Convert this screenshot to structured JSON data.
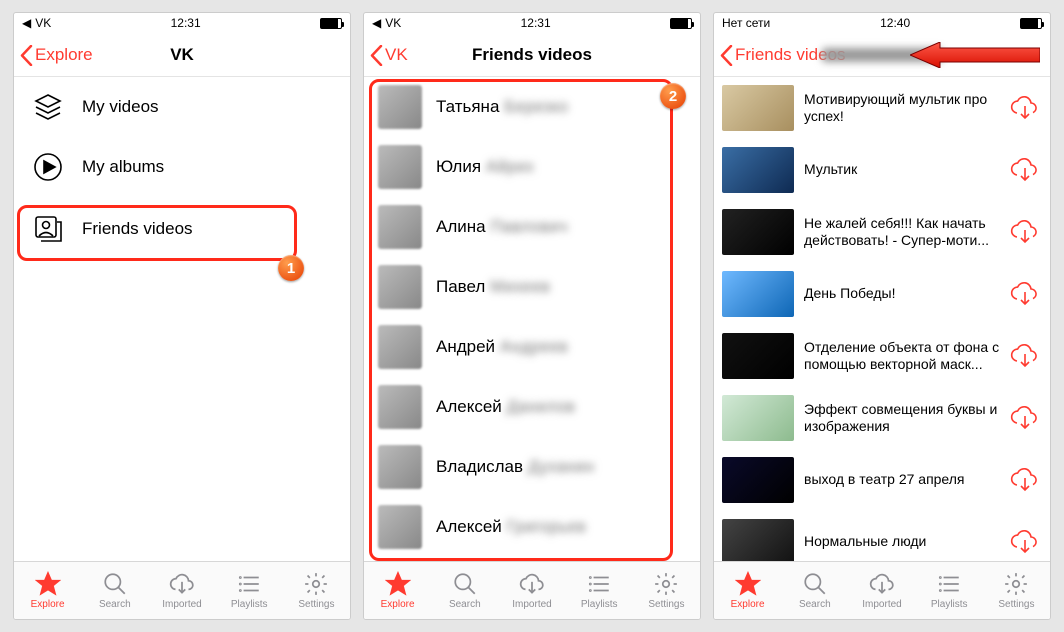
{
  "screens": [
    {
      "status": {
        "carrier": "VK",
        "time": "12:31"
      },
      "nav": {
        "back": "Explore",
        "title": "VK"
      },
      "menu": [
        {
          "label": "My videos"
        },
        {
          "label": "My albums"
        },
        {
          "label": "Friends videos"
        }
      ],
      "badge": "1"
    },
    {
      "status": {
        "carrier": "VK",
        "time": "12:31"
      },
      "nav": {
        "back": "VK",
        "title": "Friends videos"
      },
      "friends": [
        {
          "first": "Татьяна",
          "rest": "Березко"
        },
        {
          "first": "Юлия",
          "rest": "Айрих"
        },
        {
          "first": "Алина",
          "rest": "Павлович"
        },
        {
          "first": "Павел",
          "rest": "Михеев"
        },
        {
          "first": "Андрей",
          "rest": "Андреев"
        },
        {
          "first": "Алексей",
          "rest": "Данилов"
        },
        {
          "first": "Владислав",
          "rest": "Духанин"
        },
        {
          "first": "Алексей",
          "rest": "Григорьев"
        }
      ],
      "badge": "2"
    },
    {
      "status": {
        "carrier": "Нет сети",
        "time": "12:40"
      },
      "nav": {
        "back": "Friends videos",
        "title": ""
      },
      "videos": [
        {
          "title": "Мотивирующий мультик про успех!"
        },
        {
          "title": "Мультик"
        },
        {
          "title": "Не жалей себя!!! Как начать действовать! - Супер-моти..."
        },
        {
          "title": "День Победы!"
        },
        {
          "title": "Отделение объекта от фона с помощью векторной маск..."
        },
        {
          "title": "Эффект совмещения буквы и изображения"
        },
        {
          "title": "выход в театр 27 апреля"
        },
        {
          "title": "Нормальные люди"
        }
      ]
    }
  ],
  "tabs": [
    {
      "label": "Explore"
    },
    {
      "label": "Search"
    },
    {
      "label": "Imported"
    },
    {
      "label": "Playlists"
    },
    {
      "label": "Settings"
    }
  ]
}
